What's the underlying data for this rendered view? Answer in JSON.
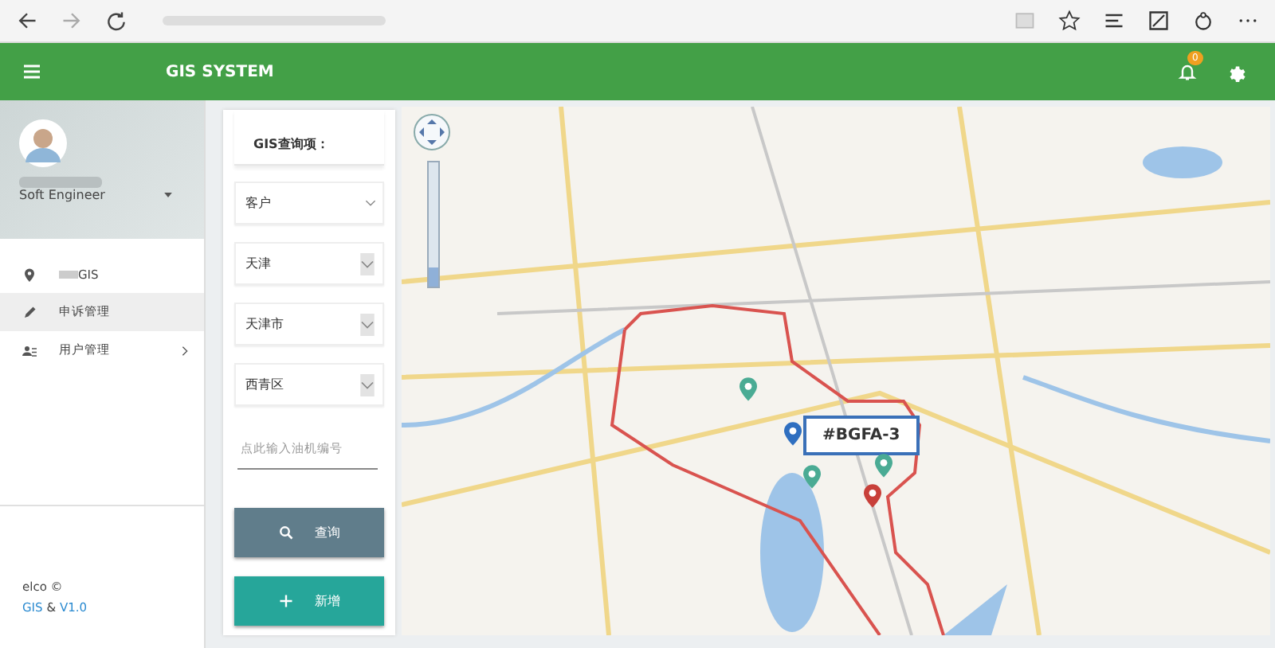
{
  "header": {
    "title": "GIS SYSTEM",
    "notification_count": "0"
  },
  "profile": {
    "role": "Soft Engineer"
  },
  "menu": [
    {
      "kind": "pin",
      "label": "GIS",
      "selected": false,
      "has_children": false
    },
    {
      "kind": "pencil",
      "label": "申诉管理",
      "selected": true,
      "has_children": false
    },
    {
      "kind": "users",
      "label": "用户管理",
      "selected": false,
      "has_children": true
    }
  ],
  "footer": {
    "line1": "elco ©",
    "link1": "GIS",
    "sep": "&",
    "link2": "V1.0"
  },
  "filter": {
    "title": "GIS查询项：",
    "selects": [
      {
        "value": "客户",
        "kind": "plain"
      },
      {
        "value": "天津",
        "kind": "boxed"
      },
      {
        "value": "天津市",
        "kind": "boxed"
      },
      {
        "value": "西青区",
        "kind": "boxed"
      }
    ],
    "input": {
      "placeholder": "点此输入油机编号"
    },
    "buttons": [
      {
        "kind": "search",
        "label": "查询"
      },
      {
        "kind": "add",
        "label": "新增"
      }
    ]
  },
  "map": {
    "zoom": {
      "level": 0.15
    },
    "popup": "#BGFA-3",
    "markers": [
      {
        "color": "#4aab94"
      },
      {
        "color": "#2f6fc0"
      },
      {
        "color": "#4aab94"
      },
      {
        "color": "#4aab94"
      },
      {
        "color": "#c8403a"
      }
    ]
  }
}
